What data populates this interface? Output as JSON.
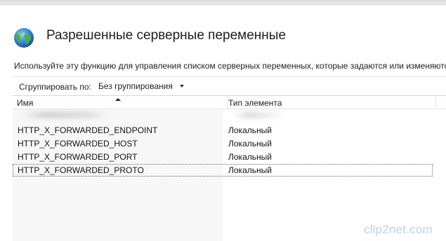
{
  "page": {
    "title": "Разрешенные серверные переменные",
    "description": "Используйте эту функцию для управления списком серверных переменных, которые задаются или изменяются"
  },
  "toolbar": {
    "group_by_label": "Сгруппировать по:",
    "group_by_value": "Без группирования"
  },
  "grid": {
    "columns": [
      {
        "label": "Имя",
        "sorted": "ascending"
      },
      {
        "label": "Тип элемента"
      }
    ],
    "rows": [
      {
        "name": "HTTP_X_FORWARDED_ENDPOINT",
        "type": "Локальный"
      },
      {
        "name": "HTTP_X_FORWARDED_HOST",
        "type": "Локальный"
      },
      {
        "name": "HTTP_X_FORWARDED_PORT",
        "type": "Локальный"
      },
      {
        "name": "HTTP_X_FORWARDED_PROTO",
        "type": "Локальный",
        "selected": true
      }
    ]
  },
  "watermark": "clip2net.com",
  "icons": {
    "page_icon": "globe-icon",
    "sort": "sort-ascending-icon",
    "dropdown": "chevron-down-icon"
  },
  "colors": {
    "text": "#1e1e1e",
    "column_tint": "#f7f7f7",
    "globe_blue": "#2f7fd1",
    "globe_green": "#4caf3c"
  }
}
